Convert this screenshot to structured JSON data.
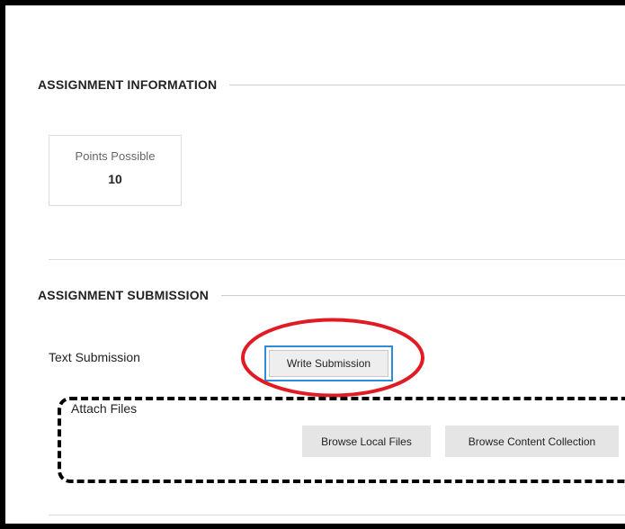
{
  "assignment_information": {
    "header": "ASSIGNMENT INFORMATION",
    "points": {
      "label": "Points Possible",
      "value": "10"
    }
  },
  "assignment_submission": {
    "header": "ASSIGNMENT SUBMISSION",
    "text_submission": {
      "label": "Text Submission",
      "button_label": "Write Submission"
    },
    "attach_files": {
      "label": "Attach Files",
      "browse_local_label": "Browse Local Files",
      "browse_content_label": "Browse Content Collection"
    }
  },
  "colors": {
    "highlight_ellipse": "#e01b24",
    "focus_border": "#2c8dd6",
    "button_gray": "#e5e5e5"
  }
}
